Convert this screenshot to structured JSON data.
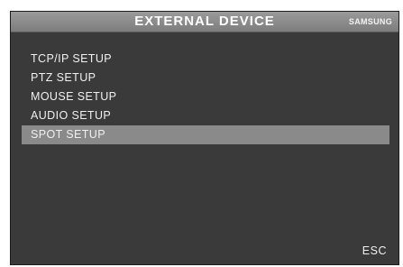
{
  "header": {
    "title": "EXTERNAL DEVICE",
    "brand": "SAMSUNG"
  },
  "menu": {
    "items": [
      {
        "label": "TCP/IP SETUP"
      },
      {
        "label": "PTZ SETUP"
      },
      {
        "label": "MOUSE SETUP"
      },
      {
        "label": "AUDIO SETUP"
      },
      {
        "label": "SPOT SETUP"
      }
    ],
    "selected_label": "SPOT SETUP"
  },
  "footer": {
    "esc_label": "ESC"
  },
  "colors": {
    "background": "#3a3a3a",
    "header": "#8a8a8a",
    "highlight": "#8a8a8a",
    "text": "#f0f0f0"
  }
}
